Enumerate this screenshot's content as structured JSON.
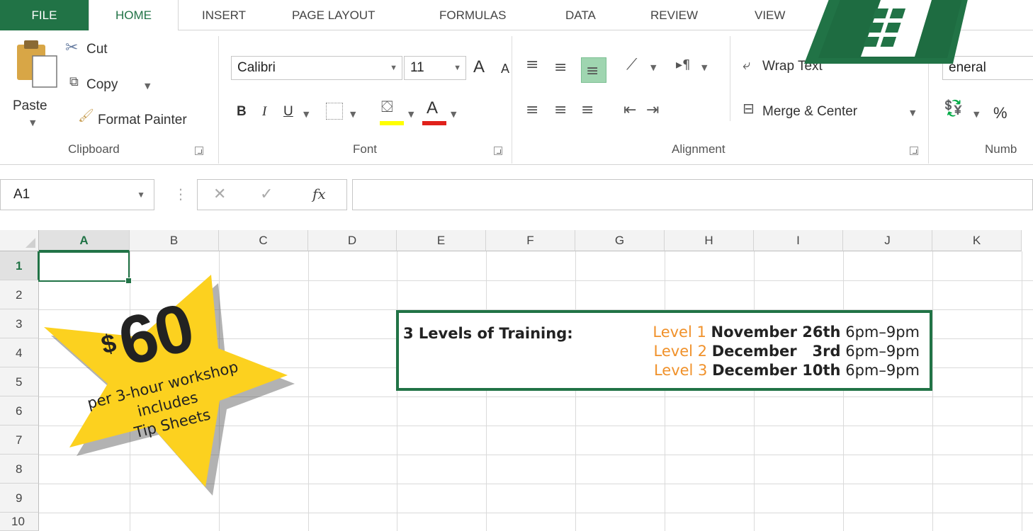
{
  "tabs": {
    "file": "FILE",
    "home": "HOME",
    "insert": "INSERT",
    "page_layout": "PAGE LAYOUT",
    "formulas": "FORMULAS",
    "data": "DATA",
    "review": "REVIEW",
    "view": "VIEW"
  },
  "clipboard": {
    "paste": "Paste",
    "cut": "Cut",
    "copy": "Copy",
    "format_painter": "Format Painter",
    "label": "Clipboard"
  },
  "font": {
    "name": "Calibri",
    "size": "11",
    "bold": "B",
    "italic": "I",
    "underline": "U",
    "grow": "A",
    "shrink": "A",
    "label": "Font"
  },
  "alignment": {
    "wrap_text": "Wrap Text",
    "merge_center": "Merge & Center",
    "label": "Alignment"
  },
  "number": {
    "format": "eneral",
    "percent": "%",
    "label": "Numb"
  },
  "formula_bar": {
    "name_box": "A1",
    "fx": "fx",
    "value": ""
  },
  "columns": [
    "A",
    "B",
    "C",
    "D",
    "E",
    "F",
    "G",
    "H",
    "I",
    "J",
    "K"
  ],
  "rows": [
    "1",
    "2",
    "3",
    "4",
    "5",
    "6",
    "7",
    "8",
    "9",
    "10"
  ],
  "selected_cell": "A1",
  "training": {
    "heading": "3 Levels of Training:",
    "sessions": [
      {
        "level": "Level 1",
        "date": "November 26th",
        "time": "6pm–9pm"
      },
      {
        "level": "Level 2",
        "date": "December   3rd",
        "time": "6pm–9pm"
      },
      {
        "level": "Level 3",
        "date": "December 10th",
        "time": "6pm–9pm"
      }
    ]
  },
  "promo": {
    "currency": "$",
    "price": "60",
    "line1": "per 3-hour workshop",
    "line2": "includes",
    "line3": "Tip Sheets"
  },
  "colors": {
    "excel_green": "#217346",
    "level_orange": "#f0912a",
    "star_yellow": "#fcd11f",
    "font_color_red": "#e0211b",
    "highlight_yellow": "#ffff00"
  }
}
